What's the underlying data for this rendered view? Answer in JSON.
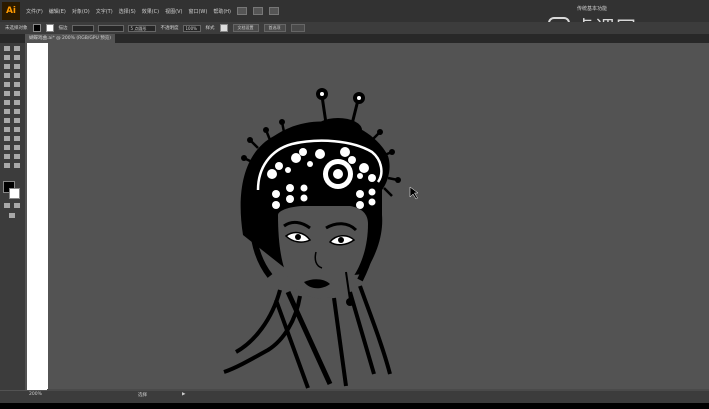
{
  "app": {
    "logo": "Ai",
    "workspace": "传统基本功能"
  },
  "menu": {
    "items": [
      "文件(F)",
      "编辑(E)",
      "对象(O)",
      "文字(T)",
      "选择(S)",
      "效果(C)",
      "视图(V)",
      "窗口(W)",
      "帮助(H)"
    ]
  },
  "control_bar": {
    "selection_label": "未选择对象",
    "stroke_label": "描边",
    "brush_value": "5 点圆形",
    "opacity_label": "不透明度",
    "opacity_value": "100%",
    "style_label": "样式",
    "doc_setup_button": "文档设置",
    "prefs_button": "首选项"
  },
  "document_tab": {
    "label": "蝴蝶戏曲.ai* @ 200% (RGB/GPU 预览)"
  },
  "status_bar": {
    "zoom": "200%",
    "tool": "选择",
    "arrow": "▶"
  },
  "watermark": {
    "brand": "虎课网"
  },
  "colors": {
    "canvas": "#535353",
    "chrome": "#323232",
    "accent_logo": "#ff9a00",
    "artwork": "#000000"
  },
  "icons": [
    "play-icon",
    "cursor-arrow-icon",
    "selection-tool-icon",
    "fill-swatch",
    "stroke-swatch"
  ]
}
